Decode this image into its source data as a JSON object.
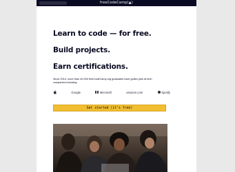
{
  "nav": {
    "brand": "freeCodeCamp(",
    "brand_icon": "flame-icon",
    "brand_suffix": ")"
  },
  "hero": {
    "line1": "Learn to code — for free.",
    "line2": "Build projects.",
    "line3": "Earn certifications.",
    "subtext": "Since 2014, more than 40,000 freeCodeCamp.org graduates have gotten jobs at tech companies including:",
    "logos": [
      {
        "icon": "apple-logo-icon",
        "label": ""
      },
      {
        "icon": "google-logo",
        "label": "Google"
      },
      {
        "icon": "microsoft-logo-icon",
        "label": "Microsoft"
      },
      {
        "icon": "amazon-logo",
        "label": "amazon.com"
      },
      {
        "icon": "spotify-logo-icon",
        "label": "Spotify"
      }
    ],
    "cta": "Get started (it's free)"
  },
  "colors": {
    "navbar": "#0a0a23",
    "cta": "#f1be32",
    "text": "#0a0a23"
  }
}
